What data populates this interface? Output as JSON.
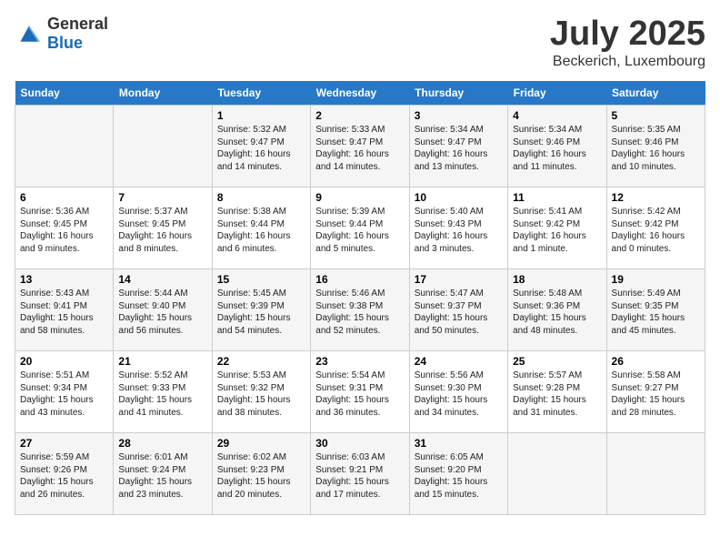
{
  "logo": {
    "general": "General",
    "blue": "Blue"
  },
  "title": {
    "month_year": "July 2025",
    "location": "Beckerich, Luxembourg"
  },
  "days_of_week": [
    "Sunday",
    "Monday",
    "Tuesday",
    "Wednesday",
    "Thursday",
    "Friday",
    "Saturday"
  ],
  "weeks": [
    [
      {
        "num": "",
        "info": ""
      },
      {
        "num": "",
        "info": ""
      },
      {
        "num": "1",
        "info": "Sunrise: 5:32 AM\nSunset: 9:47 PM\nDaylight: 16 hours and 14 minutes."
      },
      {
        "num": "2",
        "info": "Sunrise: 5:33 AM\nSunset: 9:47 PM\nDaylight: 16 hours and 14 minutes."
      },
      {
        "num": "3",
        "info": "Sunrise: 5:34 AM\nSunset: 9:47 PM\nDaylight: 16 hours and 13 minutes."
      },
      {
        "num": "4",
        "info": "Sunrise: 5:34 AM\nSunset: 9:46 PM\nDaylight: 16 hours and 11 minutes."
      },
      {
        "num": "5",
        "info": "Sunrise: 5:35 AM\nSunset: 9:46 PM\nDaylight: 16 hours and 10 minutes."
      }
    ],
    [
      {
        "num": "6",
        "info": "Sunrise: 5:36 AM\nSunset: 9:45 PM\nDaylight: 16 hours and 9 minutes."
      },
      {
        "num": "7",
        "info": "Sunrise: 5:37 AM\nSunset: 9:45 PM\nDaylight: 16 hours and 8 minutes."
      },
      {
        "num": "8",
        "info": "Sunrise: 5:38 AM\nSunset: 9:44 PM\nDaylight: 16 hours and 6 minutes."
      },
      {
        "num": "9",
        "info": "Sunrise: 5:39 AM\nSunset: 9:44 PM\nDaylight: 16 hours and 5 minutes."
      },
      {
        "num": "10",
        "info": "Sunrise: 5:40 AM\nSunset: 9:43 PM\nDaylight: 16 hours and 3 minutes."
      },
      {
        "num": "11",
        "info": "Sunrise: 5:41 AM\nSunset: 9:42 PM\nDaylight: 16 hours and 1 minute."
      },
      {
        "num": "12",
        "info": "Sunrise: 5:42 AM\nSunset: 9:42 PM\nDaylight: 16 hours and 0 minutes."
      }
    ],
    [
      {
        "num": "13",
        "info": "Sunrise: 5:43 AM\nSunset: 9:41 PM\nDaylight: 15 hours and 58 minutes."
      },
      {
        "num": "14",
        "info": "Sunrise: 5:44 AM\nSunset: 9:40 PM\nDaylight: 15 hours and 56 minutes."
      },
      {
        "num": "15",
        "info": "Sunrise: 5:45 AM\nSunset: 9:39 PM\nDaylight: 15 hours and 54 minutes."
      },
      {
        "num": "16",
        "info": "Sunrise: 5:46 AM\nSunset: 9:38 PM\nDaylight: 15 hours and 52 minutes."
      },
      {
        "num": "17",
        "info": "Sunrise: 5:47 AM\nSunset: 9:37 PM\nDaylight: 15 hours and 50 minutes."
      },
      {
        "num": "18",
        "info": "Sunrise: 5:48 AM\nSunset: 9:36 PM\nDaylight: 15 hours and 48 minutes."
      },
      {
        "num": "19",
        "info": "Sunrise: 5:49 AM\nSunset: 9:35 PM\nDaylight: 15 hours and 45 minutes."
      }
    ],
    [
      {
        "num": "20",
        "info": "Sunrise: 5:51 AM\nSunset: 9:34 PM\nDaylight: 15 hours and 43 minutes."
      },
      {
        "num": "21",
        "info": "Sunrise: 5:52 AM\nSunset: 9:33 PM\nDaylight: 15 hours and 41 minutes."
      },
      {
        "num": "22",
        "info": "Sunrise: 5:53 AM\nSunset: 9:32 PM\nDaylight: 15 hours and 38 minutes."
      },
      {
        "num": "23",
        "info": "Sunrise: 5:54 AM\nSunset: 9:31 PM\nDaylight: 15 hours and 36 minutes."
      },
      {
        "num": "24",
        "info": "Sunrise: 5:56 AM\nSunset: 9:30 PM\nDaylight: 15 hours and 34 minutes."
      },
      {
        "num": "25",
        "info": "Sunrise: 5:57 AM\nSunset: 9:28 PM\nDaylight: 15 hours and 31 minutes."
      },
      {
        "num": "26",
        "info": "Sunrise: 5:58 AM\nSunset: 9:27 PM\nDaylight: 15 hours and 28 minutes."
      }
    ],
    [
      {
        "num": "27",
        "info": "Sunrise: 5:59 AM\nSunset: 9:26 PM\nDaylight: 15 hours and 26 minutes."
      },
      {
        "num": "28",
        "info": "Sunrise: 6:01 AM\nSunset: 9:24 PM\nDaylight: 15 hours and 23 minutes."
      },
      {
        "num": "29",
        "info": "Sunrise: 6:02 AM\nSunset: 9:23 PM\nDaylight: 15 hours and 20 minutes."
      },
      {
        "num": "30",
        "info": "Sunrise: 6:03 AM\nSunset: 9:21 PM\nDaylight: 15 hours and 17 minutes."
      },
      {
        "num": "31",
        "info": "Sunrise: 6:05 AM\nSunset: 9:20 PM\nDaylight: 15 hours and 15 minutes."
      },
      {
        "num": "",
        "info": ""
      },
      {
        "num": "",
        "info": ""
      }
    ]
  ]
}
